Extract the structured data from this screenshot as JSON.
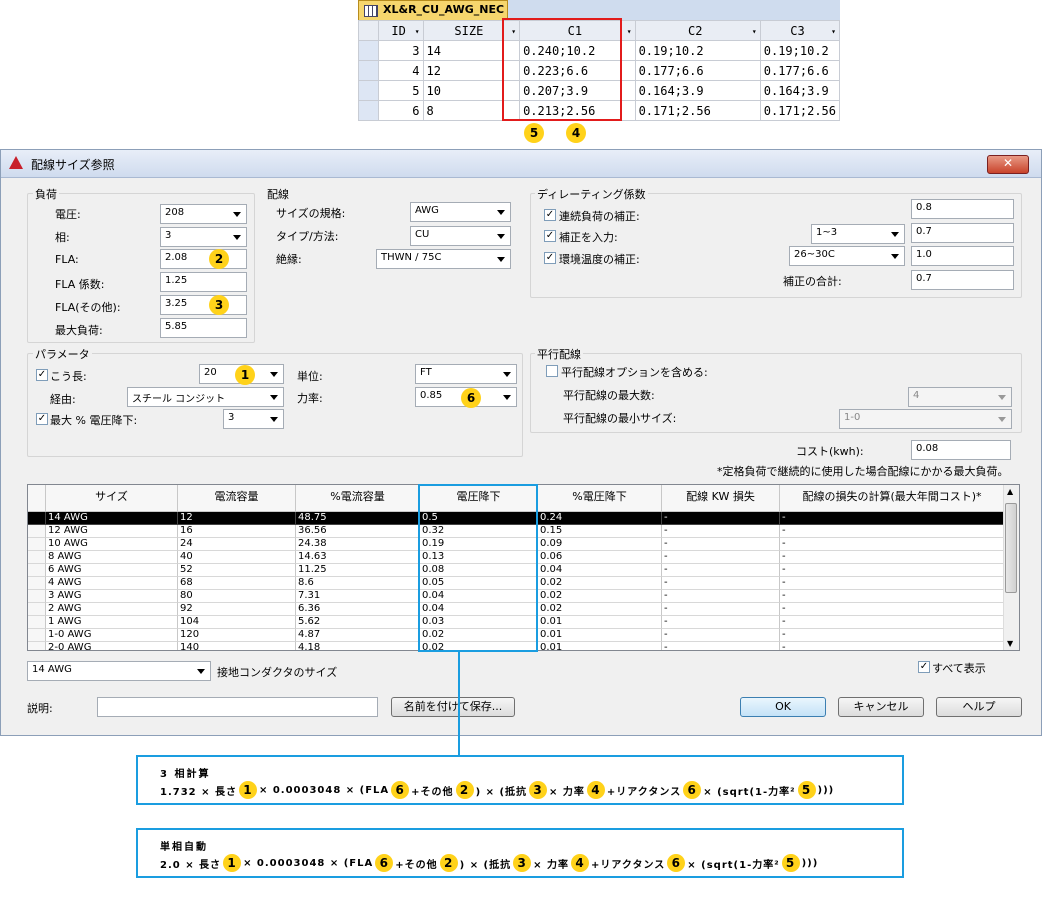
{
  "top_table": {
    "tab_title": "XL&R_CU_AWG_NEC",
    "headers": [
      "ID",
      "SIZE",
      "C1",
      "C2",
      "C3"
    ],
    "rows": [
      {
        "id": "3",
        "size": "14",
        "c1": "0.240;10.2",
        "c2": "0.19;10.2",
        "c3": "0.19;10.2"
      },
      {
        "id": "4",
        "size": "12",
        "c1": "0.223;6.6",
        "c2": "0.177;6.6",
        "c3": "0.177;6.6"
      },
      {
        "id": "5",
        "size": "10",
        "c1": "0.207;3.9",
        "c2": "0.164;3.9",
        "c3": "0.164;3.9"
      },
      {
        "id": "6",
        "size": "8",
        "c1": "0.213;2.56",
        "c2": "0.171;2.56",
        "c3": "0.171;2.56"
      }
    ],
    "badges": [
      "5",
      "4"
    ]
  },
  "dialog": {
    "title": "配線サイズ参照",
    "close": "✕",
    "load": {
      "legend": "負荷",
      "voltage_label": "電圧:",
      "voltage": "208",
      "phase_label": "相:",
      "phase": "3",
      "fla_label": "FLA:",
      "fla": "2.08",
      "fla_badge": "2",
      "fla_factor_label": "FLA 係数:",
      "fla_factor": "1.25",
      "fla_other_label": "FLA(その他):",
      "fla_other": "3.25",
      "fla_other_badge": "3",
      "max_load_label": "最大負荷:",
      "max_load": "5.85"
    },
    "wiring": {
      "legend": "配線",
      "standard_label": "サイズの規格:",
      "standard": "AWG",
      "type_label": "タイプ/方法:",
      "type": "CU",
      "insulation_label": "絶縁:",
      "insulation": "THWN / 75C"
    },
    "derating": {
      "legend": "ディレーティング係数",
      "continuous_label": "連続負荷の補正:",
      "continuous": "0.8",
      "input_label": "補正を入力:",
      "input_select": "1~3",
      "input": "0.7",
      "ambient_label": "環境温度の補正:",
      "ambient_select": "26~30C",
      "ambient": "1.0",
      "total_label": "補正の合計:",
      "total": "0.7"
    },
    "params": {
      "legend": "パラメータ",
      "length_label": "こう長:",
      "length": "20",
      "length_badge": "1",
      "route_label": "経由:",
      "route": "スチール コンジット",
      "max_drop_label": "最大 % 電圧降下:",
      "max_drop": "3",
      "unit_label": "単位:",
      "unit": "FT",
      "pf_label": "力率:",
      "pf": "0.85",
      "pf_badge": "6"
    },
    "parallel": {
      "legend": "平行配線",
      "include_label": "平行配線オプションを含める:",
      "max_count_label": "平行配線の最大数:",
      "max_count": "4",
      "min_size_label": "平行配線の最小サイズ:",
      "min_size": "1-0"
    },
    "cost_label": "コスト(kwh):",
    "cost": "0.08",
    "note": "*定格負荷で継続的に使用した場合配線にかかる最大負荷。",
    "grid_headers": [
      "サイズ",
      "電流容量",
      "%電流容量",
      "電圧降下",
      "%電圧降下",
      "配線 KW 損失",
      "配線の損失の計算(最大年間コスト)*"
    ],
    "grid_rows": [
      [
        "14 AWG",
        "12",
        "48.75",
        "0.5",
        "0.24",
        "-",
        "-"
      ],
      [
        "12 AWG",
        "16",
        "36.56",
        "0.32",
        "0.15",
        "-",
        "-"
      ],
      [
        "10 AWG",
        "24",
        "24.38",
        "0.19",
        "0.09",
        "-",
        "-"
      ],
      [
        "8 AWG",
        "40",
        "14.63",
        "0.13",
        "0.06",
        "-",
        "-"
      ],
      [
        "6 AWG",
        "52",
        "11.25",
        "0.08",
        "0.04",
        "-",
        "-"
      ],
      [
        "4 AWG",
        "68",
        "8.6",
        "0.05",
        "0.02",
        "-",
        "-"
      ],
      [
        "3 AWG",
        "80",
        "7.31",
        "0.04",
        "0.02",
        "-",
        "-"
      ],
      [
        "2 AWG",
        "92",
        "6.36",
        "0.04",
        "0.02",
        "-",
        "-"
      ],
      [
        "1 AWG",
        "104",
        "5.62",
        "0.03",
        "0.01",
        "-",
        "-"
      ],
      [
        "1-0 AWG",
        "120",
        "4.87",
        "0.02",
        "0.01",
        "-",
        "-"
      ],
      [
        "2-0 AWG",
        "140",
        "4.18",
        "0.02",
        "0.01",
        "-",
        "-"
      ]
    ],
    "ground_size": "14 AWG",
    "ground_label": "接地コンダクタのサイズ",
    "show_all": "すべて表示",
    "desc_label": "説明:",
    "save_as": "名前を付けて保存...",
    "ok": "OK",
    "cancel": "キャンセル",
    "help": "ヘルプ"
  },
  "formula3": {
    "title": "3 相計算",
    "parts": [
      "1.732 × 長さ",
      "1",
      "× 0.0003048 × (FLA",
      "6",
      "+その他",
      "2",
      ") × (抵抗",
      "3",
      "× 力率",
      "4",
      "+リアクタンス",
      "6",
      "× (sqrt(1-力率²",
      "5",
      ")))"
    ]
  },
  "formula1": {
    "title": "単相自動",
    "parts": [
      "2.0 × 長さ",
      "1",
      "× 0.0003048 × (FLA",
      "6",
      "+その他",
      "2",
      ") × (抵抗",
      "3",
      "× 力率",
      "4",
      "+リアクタンス",
      "6",
      "× (sqrt(1-力率²",
      "5",
      ")))"
    ]
  }
}
